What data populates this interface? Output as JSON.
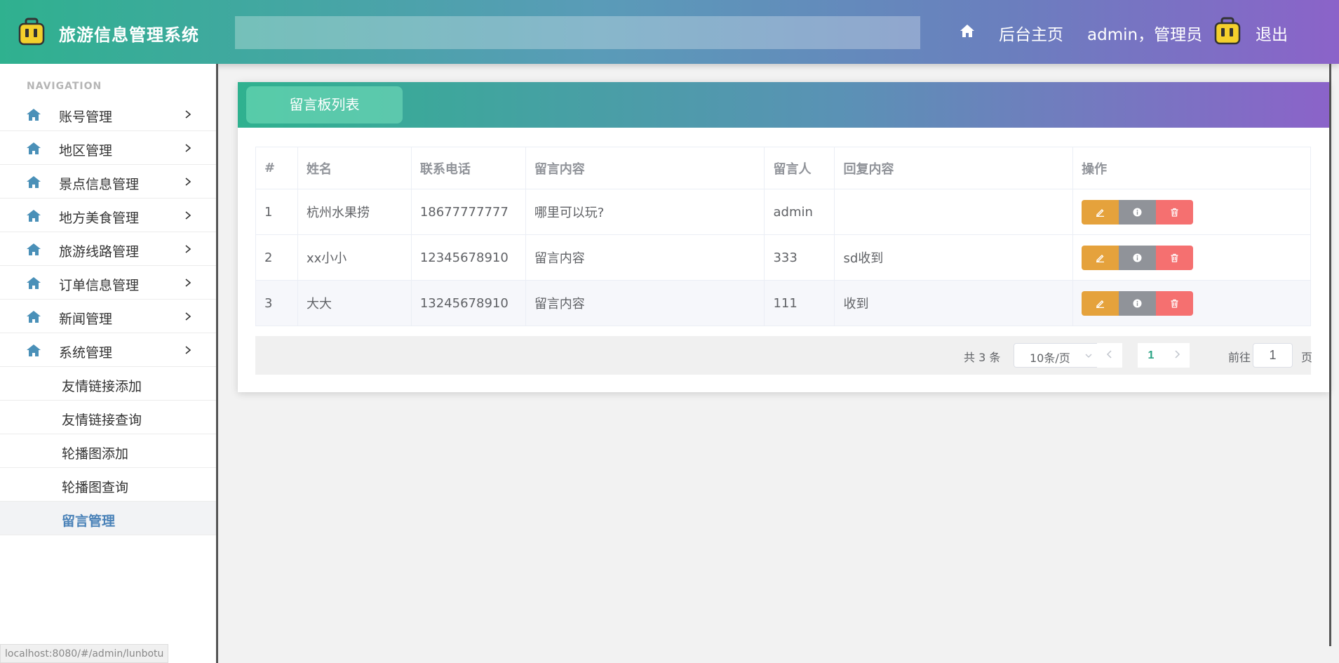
{
  "header": {
    "title": "旅游信息管理系统",
    "search_placeholder": "",
    "home_link": "后台主页",
    "user_label": "admin，管理员",
    "logout_label": "退出"
  },
  "sidebar": {
    "caption": "NAVIGATION",
    "items": [
      {
        "label": "账号管理"
      },
      {
        "label": "地区管理"
      },
      {
        "label": "景点信息管理"
      },
      {
        "label": "地方美食管理"
      },
      {
        "label": "旅游线路管理"
      },
      {
        "label": "订单信息管理"
      },
      {
        "label": "新闻管理"
      },
      {
        "label": "系统管理"
      }
    ],
    "sub_items": [
      {
        "label": "友情链接添加"
      },
      {
        "label": "友情链接查询"
      },
      {
        "label": "轮播图添加"
      },
      {
        "label": "轮播图查询"
      },
      {
        "label": "留言管理",
        "active": true
      }
    ]
  },
  "main": {
    "tab_label": "留言板列表",
    "table": {
      "headers": [
        "#",
        "姓名",
        "联系电话",
        "留言内容",
        "留言人",
        "回复内容",
        "操作"
      ],
      "rows": [
        {
          "idx": "1",
          "name": "杭州水果捞",
          "phone": "18677777777",
          "content": "哪里可以玩?",
          "author": "admin",
          "reply": ""
        },
        {
          "idx": "2",
          "name": "xx小小",
          "phone": "12345678910",
          "content": "留言内容",
          "author": "333",
          "reply": "sd收到"
        },
        {
          "idx": "3",
          "name": "大大",
          "phone": "13245678910",
          "content": "留言内容",
          "author": "111",
          "reply": "收到"
        }
      ]
    },
    "pagination": {
      "total_text": "共 3 条",
      "page_size": "10条/页",
      "current_page": "1",
      "jump_label": "前往",
      "jump_value": "1",
      "jump_unit": "页"
    }
  },
  "status_bar": {
    "url": "localhost:8080/#/admin/lunbotu"
  },
  "colors": {
    "accent": "#2fb18f",
    "accent_end": "#8b63c9",
    "edit": "#e5a23c",
    "info": "#909399",
    "delete": "#f57070",
    "active_nav": "#4a82b8"
  },
  "icons": {
    "logo": "briefcase-icon",
    "home": "home-icon",
    "nav": "house-icon",
    "expand": "chevron-right-icon",
    "edit": "pencil-icon",
    "info": "info-icon",
    "delete": "trash-icon"
  }
}
